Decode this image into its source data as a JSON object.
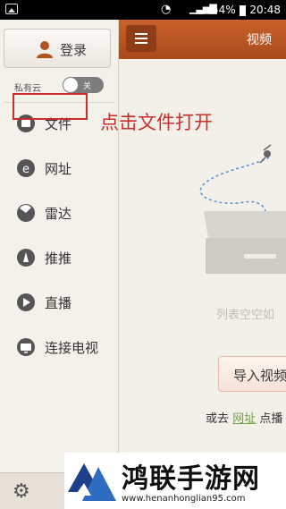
{
  "status_bar": {
    "battery": "54%",
    "time": "20:48"
  },
  "sidebar": {
    "login_label": "登录",
    "private_cloud_label": "私有云",
    "toggle_text": "关",
    "items": [
      {
        "label": "文件",
        "icon": "file-icon"
      },
      {
        "label": "网址",
        "icon": "browser-icon"
      },
      {
        "label": "雷达",
        "icon": "radar-icon"
      },
      {
        "label": "推推",
        "icon": "push-icon"
      },
      {
        "label": "直播",
        "icon": "live-icon"
      },
      {
        "label": "连接电视",
        "icon": "tv-icon"
      }
    ]
  },
  "header": {
    "title": "视频"
  },
  "annotation": "点击文件打开",
  "main": {
    "empty_text": "列表空空如",
    "import_label": "导入视频",
    "or_prefix": "或去",
    "or_link": "网址",
    "or_suffix": "点播"
  },
  "watermark": {
    "title": "鸿联手游网",
    "url": "www.henanhonglian95.com"
  },
  "colors": {
    "accent": "#b4521f",
    "highlight": "#c92f2a",
    "link": "#6aa839"
  }
}
